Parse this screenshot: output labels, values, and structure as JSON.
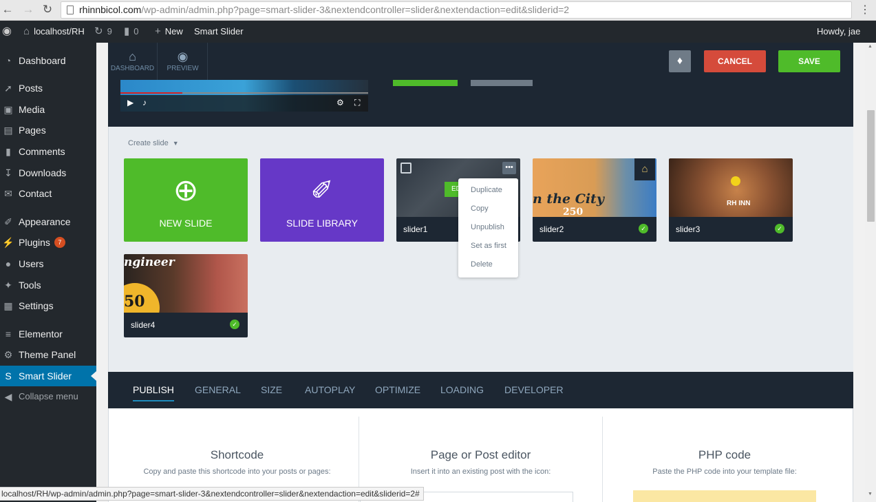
{
  "browser": {
    "url_domain": "rhinnbicol.com",
    "url_path": "/wp-admin/admin.php?page=smart-slider-3&nextendcontroller=slider&nextendaction=edit&sliderid=2",
    "status_url": "localhost/RH/wp-admin/admin.php?page=smart-slider-3&nextendcontroller=slider&nextendaction=edit&sliderid=2#"
  },
  "adminbar": {
    "site": "localhost/RH",
    "updates": "9",
    "comments": "0",
    "new": "New",
    "plugin": "Smart Slider",
    "howdy": "Howdy, jae"
  },
  "sidebar": {
    "items": [
      {
        "label": "Dashboard",
        "icon": "dashboard-icon"
      },
      {
        "label": "Posts",
        "icon": "pin-icon"
      },
      {
        "label": "Media",
        "icon": "media-icon"
      },
      {
        "label": "Pages",
        "icon": "pages-icon"
      },
      {
        "label": "Comments",
        "icon": "comment-icon"
      },
      {
        "label": "Downloads",
        "icon": "download-icon"
      },
      {
        "label": "Contact",
        "icon": "mail-icon"
      },
      {
        "label": "Appearance",
        "icon": "brush-icon"
      },
      {
        "label": "Plugins",
        "icon": "plug-icon",
        "badge": "7"
      },
      {
        "label": "Users",
        "icon": "user-icon"
      },
      {
        "label": "Tools",
        "icon": "wrench-icon"
      },
      {
        "label": "Settings",
        "icon": "settings-icon"
      },
      {
        "label": "Elementor",
        "icon": "elementor-icon"
      },
      {
        "label": "Theme Panel",
        "icon": "gear-icon"
      },
      {
        "label": "Smart Slider",
        "icon": "smart-slider-icon"
      },
      {
        "label": "Collapse menu",
        "icon": "collapse-icon"
      }
    ]
  },
  "toolbar": {
    "dashboard": "DASHBOARD",
    "preview": "PREVIEW",
    "cancel": "CANCEL",
    "save": "SAVE"
  },
  "slides": {
    "create_slide": "Create slide",
    "new_slide": "NEW SLIDE",
    "slide_library": "SLIDE LIBRARY",
    "items": [
      {
        "name": "slider1",
        "published": false,
        "edit_label": "ED"
      },
      {
        "name": "slider2",
        "published": true,
        "thumb_text": "n the City",
        "thumb_number": "250"
      },
      {
        "name": "slider3",
        "published": true,
        "logo": "RH INN"
      },
      {
        "name": "slider4",
        "published": true,
        "thumb_text": "ngineer",
        "thumb_number": "50"
      }
    ],
    "context_menu": [
      "Duplicate",
      "Copy",
      "Unpublish",
      "Set as first",
      "Delete"
    ]
  },
  "tabs": [
    "PUBLISH",
    "GENERAL",
    "SIZE",
    "AUTOPLAY",
    "OPTIMIZE",
    "LOADING",
    "DEVELOPER"
  ],
  "publish": {
    "columns": [
      {
        "title": "Shortcode",
        "desc": "Copy and paste this shortcode into your posts or pages:"
      },
      {
        "title": "Page or Post editor",
        "desc": "Insert it into an existing post with the icon:"
      },
      {
        "title": "PHP code",
        "desc": "Paste the PHP code into your template file:"
      }
    ]
  },
  "colors": {
    "wp_dark": "#23282d",
    "ss_dark": "#1d2733",
    "accent_blue": "#0073aa",
    "green": "#4fbb2a",
    "purple": "#6638c7",
    "cancel_red": "#d54b3b"
  }
}
